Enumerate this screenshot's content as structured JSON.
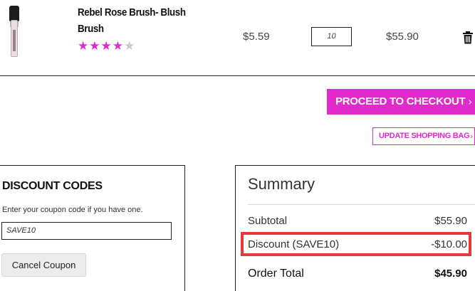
{
  "product": {
    "name": "Rebel Rose Brush- Blush Brush",
    "image_alt": "brush",
    "rating": 4,
    "rating_max": 5,
    "price": "$5.59",
    "quantity": "10",
    "subtotal": "$55.90",
    "delete_icon": "trash-icon"
  },
  "actions": {
    "checkout_label": "PROCEED TO CHECKOUT",
    "checkout_chevron": "›",
    "update_label": "UPDATE SHOPPING BAG",
    "update_chevron": "›"
  },
  "discount": {
    "title": "DISCOUNT CODES",
    "hint": "Enter your coupon code if you have one.",
    "code_value": "SAVE10",
    "cancel_label": "Cancel Coupon"
  },
  "summary": {
    "title": "Summary",
    "rows": [
      {
        "label": "Subtotal",
        "value": "$55.90"
      },
      {
        "label": "Discount (SAVE10)",
        "value": "-$10.00"
      },
      {
        "label": "Order Total",
        "value": "$45.90"
      }
    ]
  },
  "colors": {
    "accent": "#e02ac9",
    "highlight": "#e63a3a",
    "star_off": "#c9c9c9"
  }
}
